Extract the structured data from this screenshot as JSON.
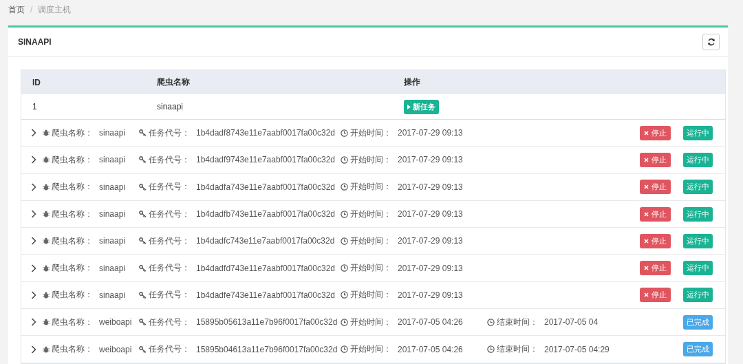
{
  "breadcrumb_separator": "/",
  "breadcrumb": [
    {
      "label": "首页",
      "selected": false
    },
    {
      "label": "调度主机",
      "selected": true
    }
  ],
  "panel": {
    "title": "SINAAPI"
  },
  "table": {
    "columns": [
      "ID",
      "爬虫名称",
      "操作"
    ],
    "rows": [
      {
        "id": "1",
        "name": "sinaapi",
        "action": "新任务"
      }
    ]
  },
  "tasks": [
    {
      "name_label": "爬虫名称：",
      "name": "sinaapi",
      "code_label": "任务代号：",
      "code": "1b4dadf8743e11e7aabf0017fa00c32d",
      "start_label": "开始时间：",
      "start": "2017-07-29 09:13",
      "stop": "停止",
      "status": {
        "kind": "running",
        "label": "运行中"
      }
    },
    {
      "name_label": "爬虫名称：",
      "name": "sinaapi",
      "code_label": "任务代号：",
      "code": "1b4dadf9743e11e7aabf0017fa00c32d",
      "start_label": "开始时间：",
      "start": "2017-07-29 09:13",
      "stop": "停止",
      "status": {
        "kind": "running",
        "label": "运行中"
      }
    },
    {
      "name_label": "爬虫名称：",
      "name": "sinaapi",
      "code_label": "任务代号：",
      "code": "1b4dadfa743e11e7aabf0017fa00c32d",
      "start_label": "开始时间：",
      "start": "2017-07-29 09:13",
      "stop": "停止",
      "status": {
        "kind": "running",
        "label": "运行中"
      }
    },
    {
      "name_label": "爬虫名称：",
      "name": "sinaapi",
      "code_label": "任务代号：",
      "code": "1b4dadfb743e11e7aabf0017fa00c32d",
      "start_label": "开始时间：",
      "start": "2017-07-29 09:13",
      "stop": "停止",
      "status": {
        "kind": "running",
        "label": "运行中"
      }
    },
    {
      "name_label": "爬虫名称：",
      "name": "sinaapi",
      "code_label": "任务代号：",
      "code": "1b4dadfc743e11e7aabf0017fa00c32d",
      "start_label": "开始时间：",
      "start": "2017-07-29 09:13",
      "stop": "停止",
      "status": {
        "kind": "running",
        "label": "运行中"
      }
    },
    {
      "name_label": "爬虫名称：",
      "name": "sinaapi",
      "code_label": "任务代号：",
      "code": "1b4dadfd743e11e7aabf0017fa00c32d",
      "start_label": "开始时间：",
      "start": "2017-07-29 09:13",
      "stop": "停止",
      "status": {
        "kind": "running",
        "label": "运行中"
      }
    },
    {
      "name_label": "爬虫名称：",
      "name": "sinaapi",
      "code_label": "任务代号：",
      "code": "1b4dadfe743e11e7aabf0017fa00c32d",
      "start_label": "开始时间：",
      "start": "2017-07-29 09:13",
      "stop": "停止",
      "status": {
        "kind": "running",
        "label": "运行中"
      }
    },
    {
      "name_label": "爬虫名称：",
      "name": "weiboapi",
      "code_label": "任务代号：",
      "code": "15895b05613a11e7b96f0017fa00c32d",
      "start_label": "开始时间：",
      "start": "2017-07-05 04:26",
      "end_label": "结束时间：",
      "end": "2017-07-05 04",
      "status": {
        "kind": "done",
        "label": "已完成"
      }
    },
    {
      "name_label": "爬虫名称：",
      "name": "weiboapi",
      "code_label": "任务代号：",
      "code": "15895b04613a11e7b96f0017fa00c32d",
      "start_label": "开始时间：",
      "start": "2017-07-05 04:26",
      "end_label": "结束时间：",
      "end": "2017-07-05 04:29",
      "status": {
        "kind": "done",
        "label": "已完成"
      }
    }
  ]
}
